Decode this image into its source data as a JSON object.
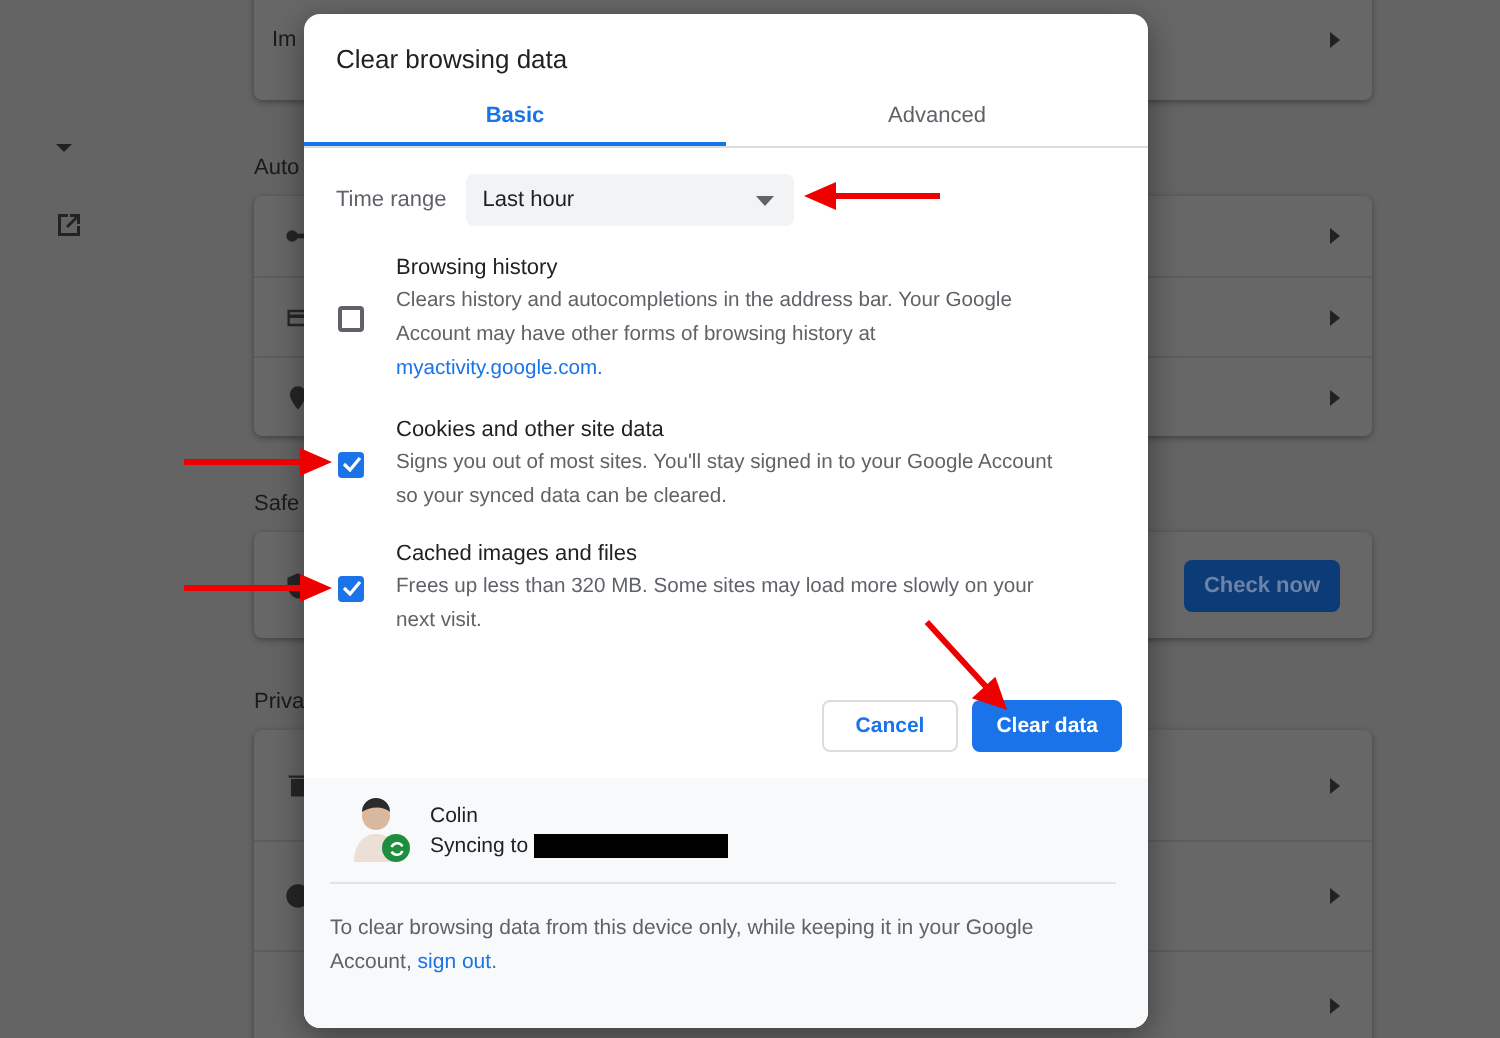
{
  "settings_page": {
    "sections": [
      {
        "rows": [
          {
            "kind": "plain",
            "label": "Im"
          }
        ]
      },
      {
        "heading": "Auto",
        "rows": [
          {
            "kind": "key"
          },
          {
            "kind": "card"
          },
          {
            "kind": "pin"
          }
        ]
      },
      {
        "heading": "Safe",
        "rows": [
          {
            "kind": "shield",
            "button": "Check now"
          }
        ]
      },
      {
        "heading": "Priva",
        "rows": [
          {
            "kind": "trash"
          },
          {
            "kind": "cookie"
          },
          {
            "kind": "plain"
          }
        ]
      }
    ]
  },
  "dialog": {
    "title": "Clear browsing data",
    "tabs": [
      {
        "label": "Basic",
        "selected": true
      },
      {
        "label": "Advanced",
        "selected": false
      }
    ],
    "time_range": {
      "label": "Time range",
      "value": "Last hour"
    },
    "items": [
      {
        "title": "Browsing history",
        "description": "Clears history and autocompletions in the address bar. Your Google Account may have other forms of browsing history at ",
        "link": "myactivity.google.com.",
        "checked": false
      },
      {
        "title": "Cookies and other site data",
        "description": "Signs you out of most sites. You'll stay signed in to your Google Account so your synced data can be cleared.",
        "checked": true
      },
      {
        "title": "Cached images and files",
        "description": "Frees up less than 320 MB. Some sites may load more slowly on your next visit.",
        "checked": true
      }
    ],
    "buttons": [
      {
        "label": "Cancel",
        "kind": "secondary"
      },
      {
        "label": "Clear data",
        "kind": "primary"
      }
    ],
    "account": {
      "name": "Colin",
      "status": "Syncing to"
    },
    "footer": {
      "text": "To clear browsing data from this device only, while keeping it in your Google Account, ",
      "link": "sign out",
      "after": "."
    }
  }
}
